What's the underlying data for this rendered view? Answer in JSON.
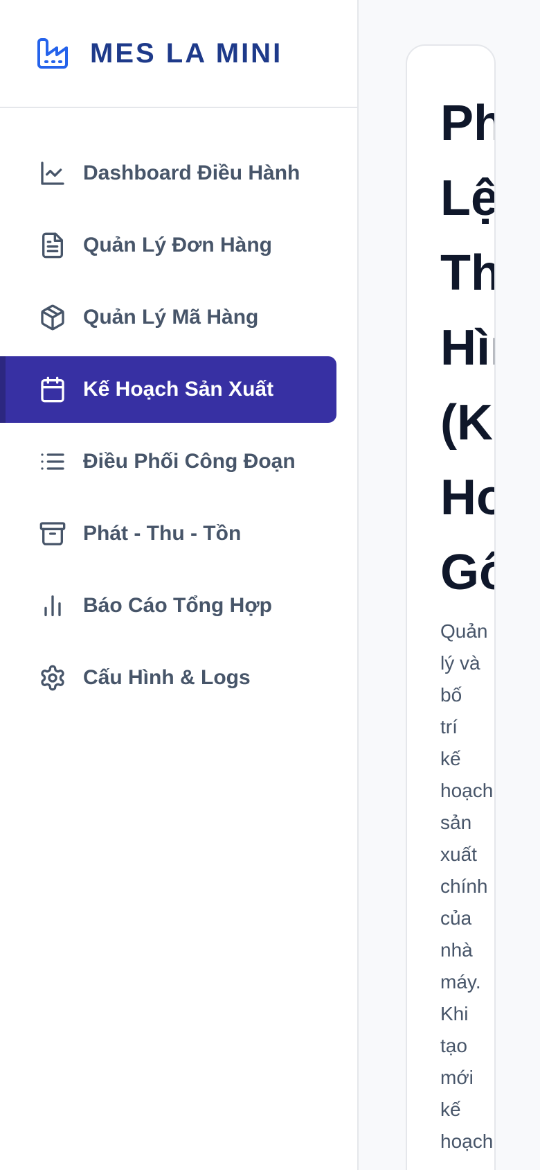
{
  "brand": {
    "name": "MES LA MINI",
    "icon": "factory-icon",
    "color": "#1e3a8a",
    "icon_color": "#2563eb"
  },
  "nav": {
    "items": [
      {
        "label": "Dashboard Điều Hành",
        "icon": "chart-line-icon"
      },
      {
        "label": "Quản Lý Đơn Hàng",
        "icon": "document-icon"
      },
      {
        "label": "Quản Lý Mã Hàng",
        "icon": "package-icon"
      },
      {
        "label": "Kế Hoạch Sản Xuất",
        "icon": "calendar-icon",
        "active": true
      },
      {
        "label": "Điều Phối Công Đoạn",
        "icon": "list-icon"
      },
      {
        "label": "Phát - Thu - Tồn",
        "icon": "archive-icon"
      },
      {
        "label": "Báo Cáo Tổng Hợp",
        "icon": "bar-chart-icon"
      },
      {
        "label": "Cấu Hình & Logs",
        "icon": "gear-icon"
      }
    ],
    "active_color": "#3730a3"
  },
  "main": {
    "title": "Ph Lệ Th Hìı (Kε Ho Gố",
    "description": "Quản lý và bố trí kế hoạch sản xuất chính của nhà máy. Khi tạo mới kế hoạch"
  }
}
